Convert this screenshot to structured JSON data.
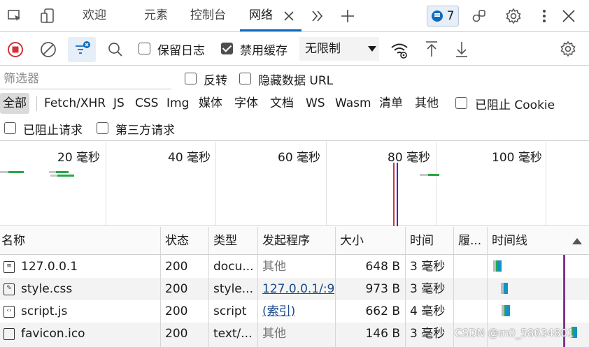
{
  "tabs": {
    "welcome": "欢迎",
    "elements": "元素",
    "console": "控制台",
    "network": "网络"
  },
  "badge": {
    "count": "7"
  },
  "toolbar": {
    "preserve_log": "保留日志",
    "disable_cache": "禁用缓存",
    "throttle": "无限制"
  },
  "filter": {
    "placeholder": "筛选器",
    "invert": "反转",
    "hide_data_urls": "隐藏数据 URL",
    "types": [
      "全部",
      "Fetch/XHR",
      "JS",
      "CSS",
      "Img",
      "媒体",
      "字体",
      "文档",
      "WS",
      "Wasm",
      "清单",
      "其他"
    ],
    "blocked_cookies": "已阻止 Cookie",
    "blocked_requests": "已阻止请求",
    "third_party": "第三方请求"
  },
  "overview": {
    "ticks": [
      "20 毫秒",
      "40 毫秒",
      "60 毫秒",
      "80 毫秒",
      "100 毫秒"
    ]
  },
  "table": {
    "headers": {
      "name": "名称",
      "status": "状态",
      "type": "类型",
      "initiator": "发起程序",
      "size": "大小",
      "time": "时间",
      "fulfilled": "履...",
      "waterfall": "时间线"
    },
    "rows": [
      {
        "name": "127.0.0.1",
        "status": "200",
        "type": "docu...",
        "initiator": "其他",
        "size": "648 B",
        "time": "3 毫秒"
      },
      {
        "name": "style.css",
        "status": "200",
        "type": "style...",
        "initiator": "127.0.0.1/:9",
        "size": "973 B",
        "time": "3 毫秒"
      },
      {
        "name": "script.js",
        "status": "200",
        "type": "script",
        "initiator": "(索引)",
        "size": "662 B",
        "time": "4 毫秒"
      },
      {
        "name": "favicon.ico",
        "status": "200",
        "type": "text/...",
        "initiator": "其他",
        "size": "146 B",
        "time": "3 毫秒"
      }
    ]
  },
  "watermark": "CSDN @m0_58634801",
  "colors": {
    "accent": "#0f6cbd",
    "record": "#d13438",
    "dom_content_loaded": "#2b2bd6",
    "load": "#d13438"
  }
}
